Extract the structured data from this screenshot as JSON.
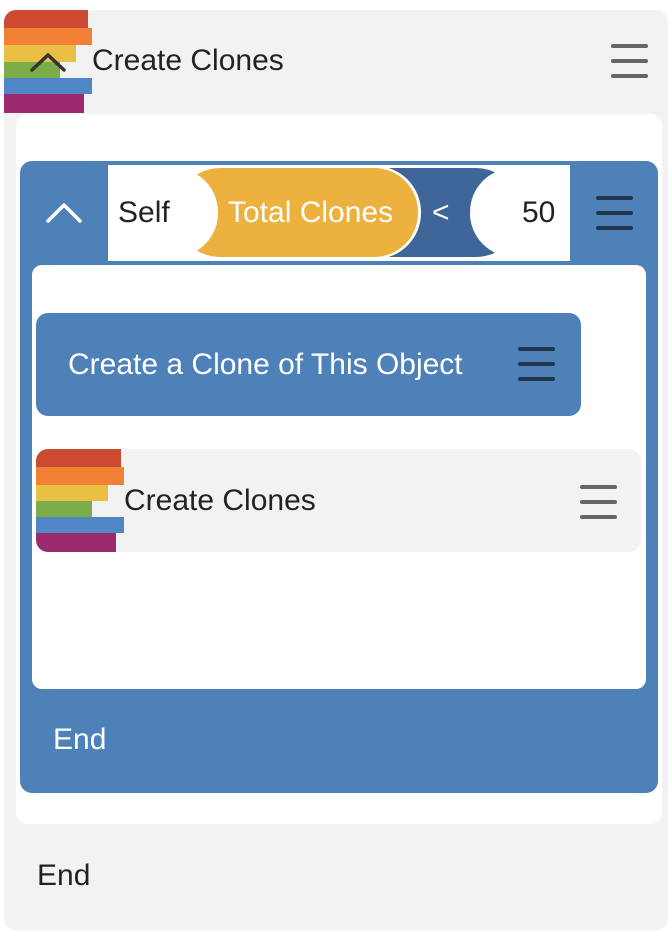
{
  "colors": {
    "outer_bg": "#f2f2f2",
    "block_blue": "#4f81b9",
    "operator_dark_blue": "#3f6698",
    "variable_gold": "#ecb13f",
    "rainbow": [
      "#cc4a31",
      "#f08033",
      "#e9bf44",
      "#7bae48",
      "#4f86c6",
      "#9b2a6f"
    ]
  },
  "icons": {
    "collapse": "chevron-up-icon",
    "menu": "hamburger-menu-icon",
    "script": "rainbow-stripes-icon"
  },
  "script_block": {
    "title": "Create Clones",
    "end_label": "End"
  },
  "while_block": {
    "left_operand": "Self",
    "variable": "Total Clones",
    "operator": "<",
    "right_operand": "50",
    "end_label": "End"
  },
  "action_block": {
    "label": "Create a Clone of This Object"
  },
  "nested_script": {
    "title": "Create Clones"
  }
}
